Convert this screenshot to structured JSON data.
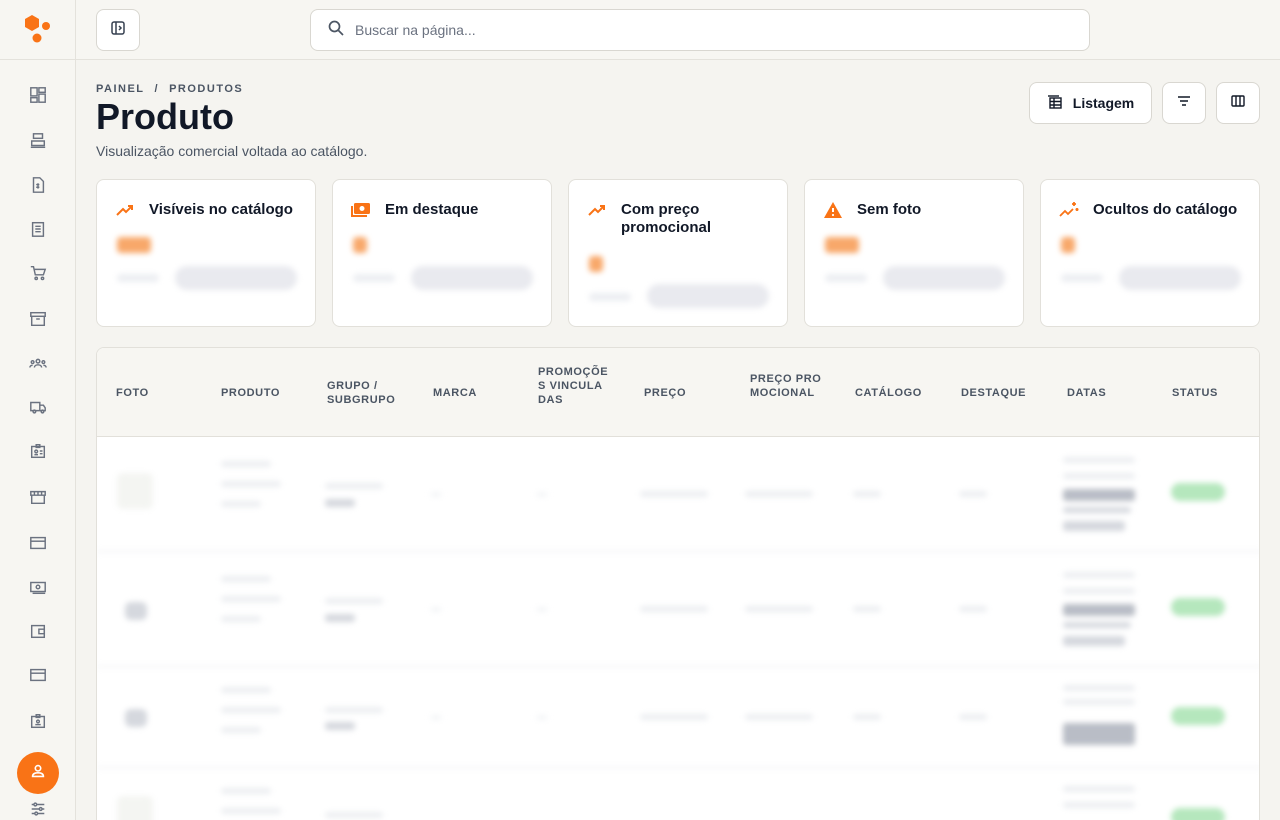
{
  "search": {
    "placeholder": "Buscar na página..."
  },
  "breadcrumb": {
    "items": [
      "PAINEL",
      "PRODUTOS"
    ],
    "separator": "/"
  },
  "page": {
    "title": "Produto",
    "subtitle": "Visualização comercial voltada ao catálogo."
  },
  "header_actions": {
    "listagem_label": "Listagem"
  },
  "stat_cards": [
    {
      "title": "Visíveis no catálogo",
      "icon": "trending-up-icon"
    },
    {
      "title": "Em destaque",
      "icon": "money-stack-icon"
    },
    {
      "title": "Com preço promocional",
      "icon": "trending-up-icon"
    },
    {
      "title": "Sem foto",
      "icon": "warning-icon"
    },
    {
      "title": "Ocultos do catálogo",
      "icon": "sparkle-chart-icon"
    }
  ],
  "table": {
    "columns": [
      "FOTO",
      "PRODUTO",
      "GRUPO / SUBGRUPO",
      "MARCA",
      "PROMOÇÕES VINCULADAS",
      "PREÇO",
      "PREÇO PROMOCIONAL",
      "CATÁLOGO",
      "DESTAQUE",
      "DATAS",
      "STATUS"
    ]
  },
  "sidebar": {
    "icons": [
      "dashboard-icon",
      "cash-register-icon",
      "invoice-icon",
      "clipboard-icon",
      "cart-icon",
      "archive-icon",
      "users-icon",
      "truck-icon",
      "id-badge-icon",
      "store-icon",
      "card-icon",
      "money-icon",
      "wallet-icon",
      "credit-card-icon",
      "badge-icon",
      "settings-sliders-icon"
    ]
  },
  "colors": {
    "accent": "#f97316",
    "status_active": "#b5e7bd"
  }
}
